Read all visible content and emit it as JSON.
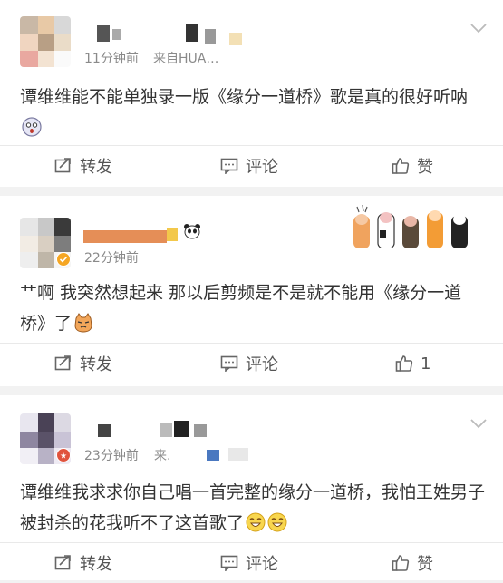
{
  "comments": [
    {
      "time": "11分钟前",
      "source": "来自HUA…",
      "text": "谭维维能不能单独录一版《缘分一道桥》歌是真的很好听呐",
      "actions": {
        "repost": "转发",
        "comment": "评论",
        "like": "赞"
      }
    },
    {
      "time": "22分钟前",
      "text": "艹啊 我突然想起来 那以后剪频是不是就不能用《缘分一道桥》了",
      "actions": {
        "repost": "转发",
        "comment": "评论",
        "like": "1"
      }
    },
    {
      "time": "23分钟前",
      "source": "来.",
      "text": "谭维维我求求你自己唱一首完整的缘分一道桥，我怕王姓男子被封杀的花我听不了这首歌了",
      "actions": {
        "repost": "转发",
        "comment": "评论",
        "like": "赞"
      }
    }
  ],
  "colors": {
    "background": "#f2f2f2",
    "card": "#ffffff",
    "muted": "#8a8a8a",
    "badge": "#f5a623"
  }
}
